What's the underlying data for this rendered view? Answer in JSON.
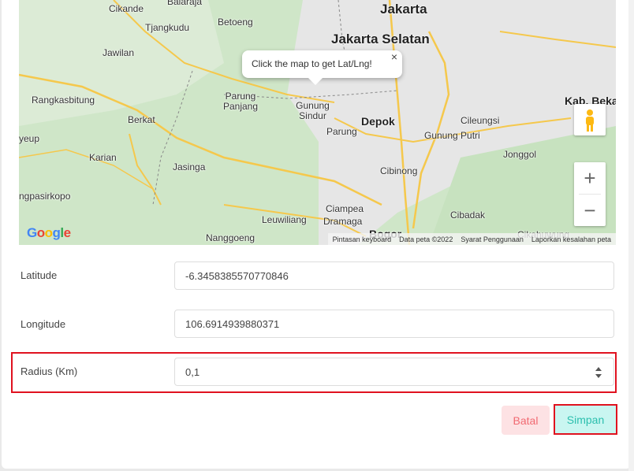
{
  "map": {
    "tooltip_text": "Click the map to get Lat/Lng!",
    "tooltip_close": "×",
    "places": [
      {
        "text": "Cikande",
        "cls": ""
      },
      {
        "text": "Balaraja",
        "cls": ""
      },
      {
        "text": "Jakarta",
        "cls": "big"
      },
      {
        "text": "Tjangkudu",
        "cls": ""
      },
      {
        "text": "Betoeng",
        "cls": ""
      },
      {
        "text": "Jakarta Selatan",
        "cls": "big"
      },
      {
        "text": "Jawilan",
        "cls": ""
      },
      {
        "text": "Rangkasbitung",
        "cls": ""
      },
      {
        "text": "Parung Panjang",
        "cls": ""
      },
      {
        "text": "Gunung Sindur",
        "cls": ""
      },
      {
        "text": "Kab. Beka",
        "cls": "mid"
      },
      {
        "text": "Berkat",
        "cls": ""
      },
      {
        "text": "Depok",
        "cls": "mid"
      },
      {
        "text": "Cileungsi",
        "cls": ""
      },
      {
        "text": "yeup",
        "cls": ""
      },
      {
        "text": "Parung",
        "cls": ""
      },
      {
        "text": "Gunung Putri",
        "cls": ""
      },
      {
        "text": "Karian",
        "cls": ""
      },
      {
        "text": "Jonggol",
        "cls": ""
      },
      {
        "text": "Jasinga",
        "cls": ""
      },
      {
        "text": "Cibinong",
        "cls": ""
      },
      {
        "text": "ngpasirkopo",
        "cls": ""
      },
      {
        "text": "Ciampea",
        "cls": ""
      },
      {
        "text": "Cibadak",
        "cls": ""
      },
      {
        "text": "Leuwiliang",
        "cls": ""
      },
      {
        "text": "Dramaga",
        "cls": ""
      },
      {
        "text": "Nanggoeng",
        "cls": ""
      },
      {
        "text": "Bogor",
        "cls": "mid"
      },
      {
        "text": "Cikahuwung",
        "cls": ""
      }
    ],
    "google_logo": "Google",
    "attribution": {
      "shortcuts": "Pintasan keyboard",
      "map_data": "Data peta ©2022",
      "terms": "Syarat Penggunaan",
      "report": "Laporkan kesalahan peta"
    },
    "zoom_in": "+",
    "zoom_out": "−"
  },
  "form": {
    "latitude_label": "Latitude",
    "latitude_value": "-6.3458385570770846",
    "longitude_label": "Longitude",
    "longitude_value": "106.6914939880371",
    "radius_label": "Radius (Km)",
    "radius_value": "0,1"
  },
  "buttons": {
    "cancel": "Batal",
    "save": "Simpan"
  },
  "colors": {
    "highlight": "#e0121f",
    "save_text": "#2bbfae",
    "save_bg": "#c9f6f1",
    "cancel_text": "#f16a72",
    "cancel_bg": "#fde2e4"
  }
}
